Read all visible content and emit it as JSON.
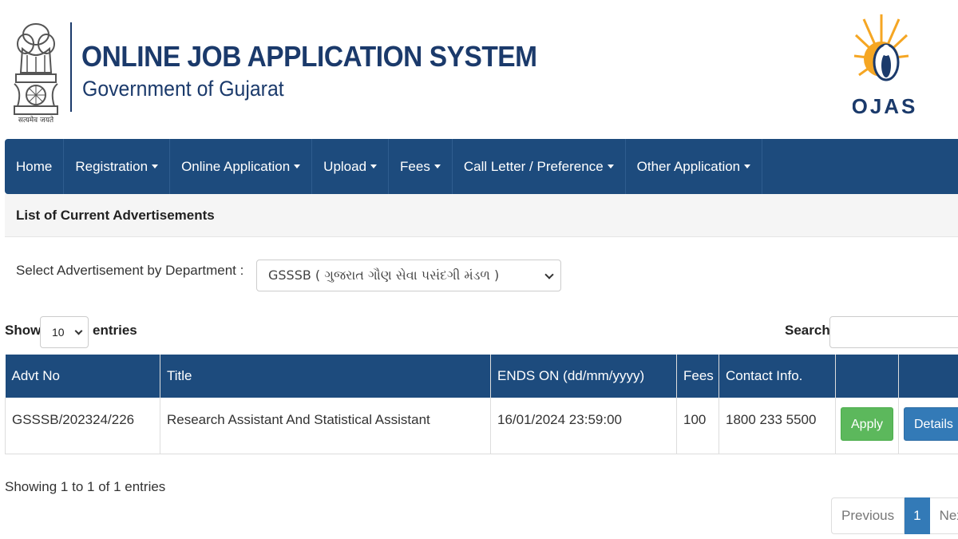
{
  "header": {
    "title": "ONLINE JOB APPLICATION SYSTEM",
    "subtitle": "Government of Gujarat",
    "emblem_motto": "सत्यमेव जयते",
    "logo_text": "OJAS"
  },
  "nav": {
    "items": [
      {
        "label": "Home",
        "dropdown": false
      },
      {
        "label": "Registration",
        "dropdown": true
      },
      {
        "label": "Online Application",
        "dropdown": true
      },
      {
        "label": "Upload",
        "dropdown": true
      },
      {
        "label": "Fees",
        "dropdown": true
      },
      {
        "label": "Call Letter / Preference",
        "dropdown": true
      },
      {
        "label": "Other Application",
        "dropdown": true
      }
    ]
  },
  "panel": {
    "heading": "List of Current Advertisements"
  },
  "filter": {
    "label": "Select Advertisement by Department :",
    "selected": "GSSSB ( ગુજરાત ગૌણ સેવા પસંદગી મંડળ )"
  },
  "table_controls": {
    "show_label": "Show",
    "entries_value": "10",
    "entries_label": "entries",
    "search_label": "Search:"
  },
  "table": {
    "columns": [
      "Advt No",
      "Title",
      "ENDS ON (dd/mm/yyyy)",
      "Fees",
      "Contact Info.",
      "",
      ""
    ],
    "rows": [
      {
        "advt_no": "GSSSB/202324/226",
        "title": "Research Assistant And Statistical Assistant",
        "ends_on": "16/01/2024 23:59:00",
        "fees": "100",
        "contact": "1800 233 5500",
        "apply_label": "Apply",
        "details_label": "Details"
      }
    ]
  },
  "info": "Showing 1 to 1 of 1 entries",
  "pagination": {
    "previous": "Previous",
    "current": "1",
    "next": "Next"
  },
  "colors": {
    "navbar": "#1d4b7d",
    "title": "#1b3a6b",
    "apply": "#5cb85c",
    "details": "#337ab7"
  }
}
